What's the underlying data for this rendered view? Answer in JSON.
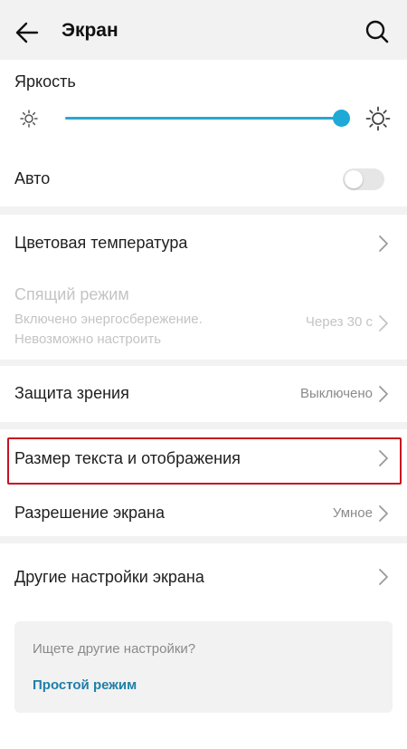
{
  "header": {
    "title": "Экран",
    "back_icon": "arrow-left-icon",
    "search_icon": "search-icon"
  },
  "brightness": {
    "label": "Яркость",
    "level": 1.0,
    "accent_color": "#1ea9d6",
    "min_icon": "sun-small-icon",
    "max_icon": "sun-large-icon"
  },
  "auto": {
    "label": "Авто",
    "enabled": false
  },
  "color_temperature": {
    "label": "Цветовая температура"
  },
  "sleep": {
    "label": "Спящий режим",
    "value": "Через 30 с",
    "note_line1": "Включено энергосбережение.",
    "note_line2": "Невозможно настроить"
  },
  "eye_protection": {
    "label": "Защита зрения",
    "value": "Выключено"
  },
  "text_size": {
    "label": "Размер текста и отображения",
    "highlight_color": "#c6121f"
  },
  "resolution": {
    "label": "Разрешение экрана",
    "value": "Умное"
  },
  "other": {
    "label": "Другие настройки экрана"
  },
  "suggestions": {
    "question": "Ищете другие настройки?",
    "link": "Простой режим",
    "link_color": "#1e7fa8"
  }
}
